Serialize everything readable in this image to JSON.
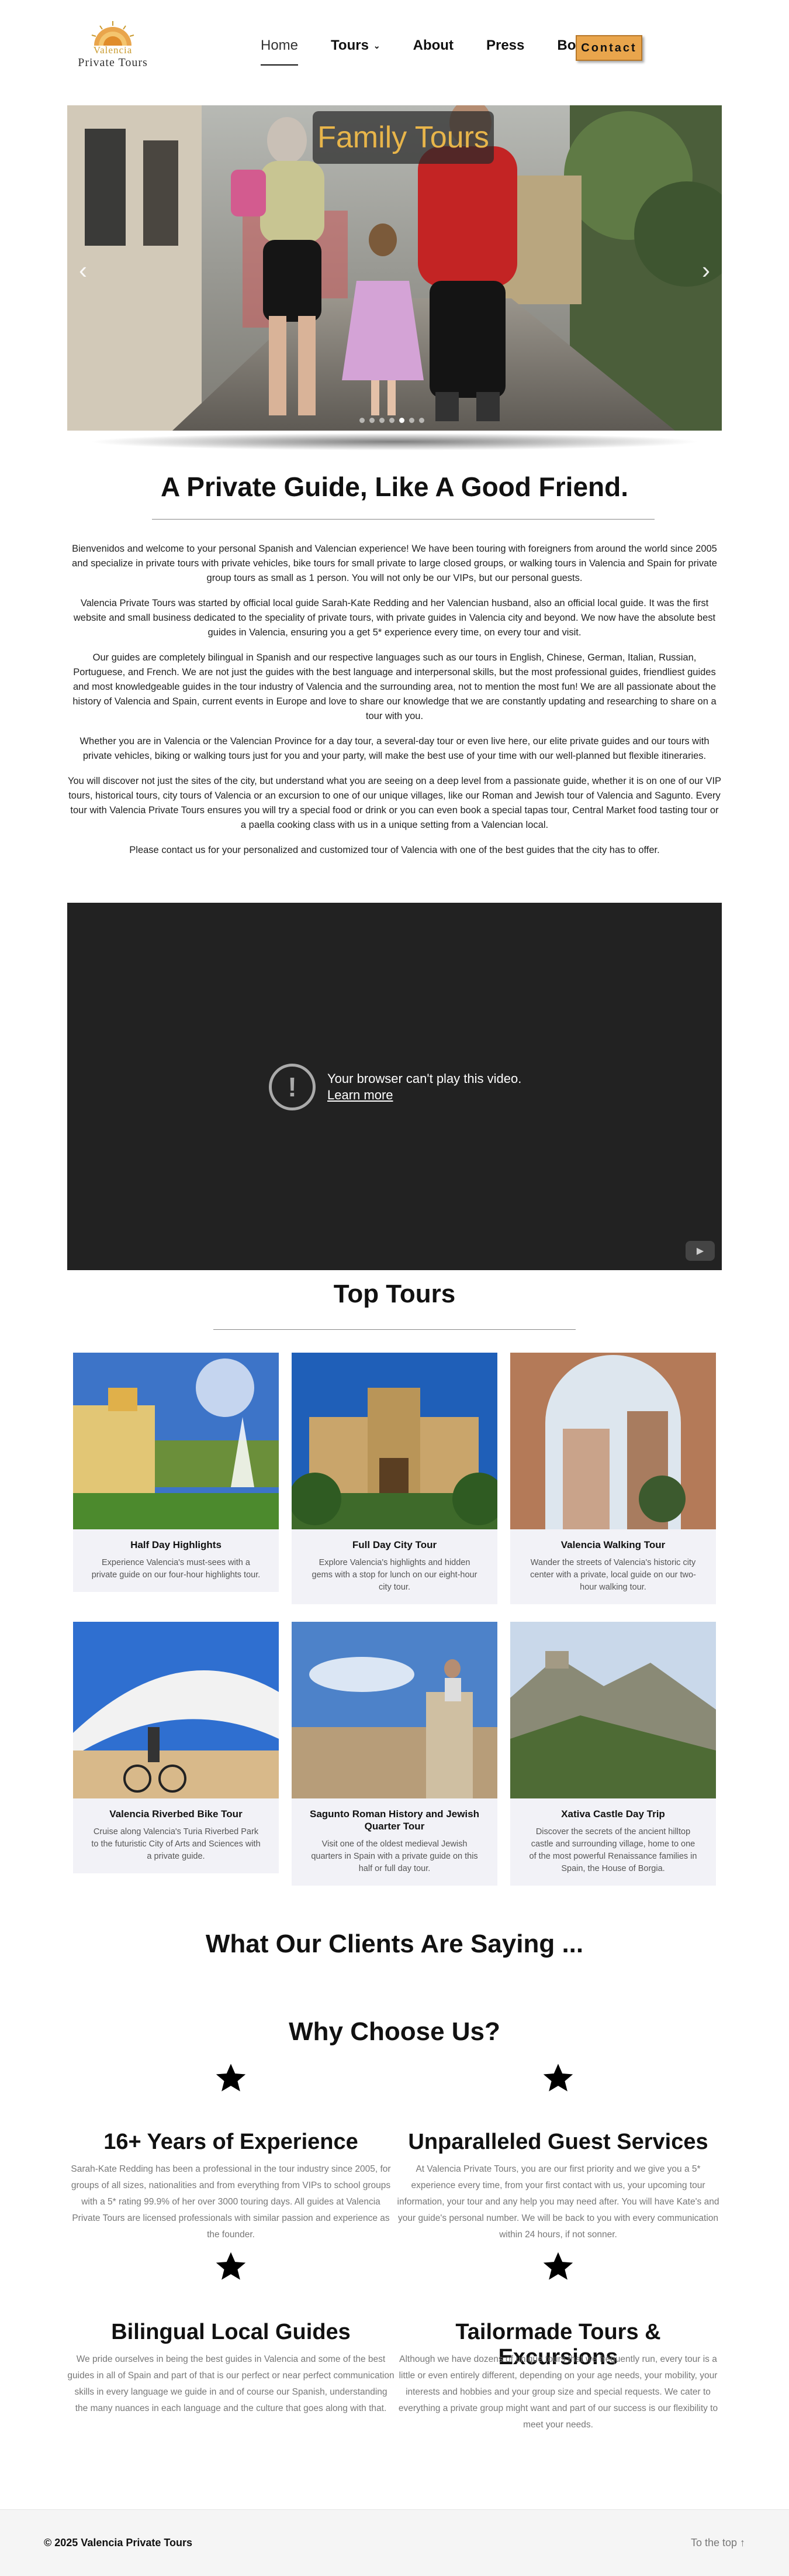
{
  "header": {
    "logo": {
      "line1": "Valencia",
      "line2": "Private Tours"
    },
    "nav": [
      {
        "label": "Home",
        "active": true
      },
      {
        "label": "Tours",
        "dropdown": true
      },
      {
        "label": "About"
      },
      {
        "label": "Press"
      },
      {
        "label": "Booking"
      }
    ],
    "contact_label": "Contact"
  },
  "hero": {
    "title": "Family Tours",
    "prev_icon": "chevron-left-icon",
    "next_icon": "chevron-right-icon",
    "slide_count": 7,
    "active_slide": 4
  },
  "intro": {
    "heading": "A Private Guide, Like A Good Friend.",
    "paragraphs": [
      "Bienvenidos and welcome to your personal Spanish and Valencian experience! We have been touring with foreigners from around the world since 2005 and specialize in private tours with private vehicles, bike tours for small private to large closed groups, or walking tours in Valencia and Spain for private group tours as small as 1 person. You will not only be our VIPs, but our personal guests.",
      "Valencia Private Tours was started by official local guide Sarah-Kate Redding and her Valencian husband, also an official local guide. It was the first website and small business dedicated to the speciality of private tours, with private guides in Valencia city and beyond. We now have the absolute best guides in Valencia, ensuring you a get 5* experience every time, on every tour and visit.",
      "Our guides are completely bilingual in Spanish and our respective languages such as our tours in English, Chinese, German, Italian, Russian, Portuguese, and French. We are not just the guides with the best language and interpersonal skills, but the most professional guides, friendliest guides and most knowledgeable guides in the tour industry of Valencia and the surrounding area, not to mention the most fun! We are all passionate about the history of Valencia and Spain, current events in Europe and love to share our knowledge that we are constantly updating and researching to share on a tour with you.",
      "Whether you are in Valencia or the Valencian Province for a day tour, a several-day tour or even live here, our elite private guides and our tours with private vehicles, biking or walking tours just for you and your party, will make the best use of your time with our well-planned but flexible itineraries.",
      "You will discover not just the sites of the city, but understand what you are seeing on a deep level from a passionate guide, whether it is on one of our VIP tours, historical tours, city tours of Valencia or an excursion to one of our unique villages, like our Roman and Jewish tour of Valencia and Sagunto. Every tour with Valencia Private Tours ensures you will try a special food or drink or you can even book a special tapas tour, Central Market food tasting tour or a paella cooking class with us in a unique setting from a Valencian local.",
      "Please contact us for your personalized and customized tour of Valencia with one of the best guides that the city has to offer."
    ]
  },
  "video": {
    "message": "Your browser can't play this video.",
    "link": "Learn more",
    "brand": "YouTube"
  },
  "tours": {
    "heading": "Top Tours",
    "items": [
      {
        "title": "Half Day Highlights",
        "desc": "Experience Valencia's must-sees with a private guide on our four-hour highlights tour."
      },
      {
        "title": "Full Day City Tour",
        "desc": "Explore Valencia's highlights and hidden gems with a stop for lunch on our eight-hour city tour."
      },
      {
        "title": "Valencia Walking Tour",
        "desc": "Wander the streets of Valencia's historic city center with a private, local guide on our two-hour walking tour."
      },
      {
        "title": "Valencia Riverbed Bike Tour",
        "desc": "Cruise along Valencia's Turia Riverbed Park to the futuristic City of Arts and Sciences with a private guide."
      },
      {
        "title": "Sagunto Roman History and Jewish Quarter Tour",
        "desc": "Visit one of the oldest medieval Jewish quarters in Spain with a private guide on this half or full day tour."
      },
      {
        "title": "Xativa Castle Day Trip",
        "desc": "Discover the secrets of the ancient hilltop castle and surrounding village, home to one of the most powerful Renaissance families in Spain, the House of Borgia."
      }
    ]
  },
  "testimonials": {
    "heading": "What Our Clients Are Saying ..."
  },
  "why": {
    "heading": "Why Choose Us?",
    "icon": "star-icon",
    "items": [
      {
        "title": "16+ Years of Experience",
        "text": "Sarah-Kate Redding has been a professional in the tour industry since 2005, for groups of all sizes, nationalities and from everything from VIPs to school groups with a 5* rating 99.9% of her over 3000 touring days. All guides at Valencia Private Tours are licensed professionals with similar passion and experience as the founder."
      },
      {
        "title": "Unparalleled Guest Services",
        "text": "At Valencia Private Tours, you are our first priority and we give you a 5* experience every time, from your first contact with us, your upcoming tour information, your tour and any help you may need after. You will have Kate's and your guide's personal number. We will be back to you with every communication within 24 hours, if not sonner."
      },
      {
        "title": "Bilingual Local Guides",
        "text": "We pride ourselves in being the best guides in Valencia and some of the best guides in all of Spain and part of that is our perfect or near perfect communication skills in every language we guide in and of course our Spanish, understanding the many nuances in each language and the culture that goes along with that."
      },
      {
        "title": "Tailormade Tours & Excursions",
        "text": "Although we have dozens of unique tours that we frequently run, every tour is a little or even entirely different, depending on your age needs, your mobility, your interests and hobbies and your group size and special requests. We cater to everything a private group might want and part of our success is our flexibility to meet your needs."
      }
    ]
  },
  "footer": {
    "copyright": "© 2025 Valencia Private Tours",
    "to_top": "To the top ↑"
  },
  "colors": {
    "accent": "#e9a54c",
    "hero_title": "#e8b54a",
    "card_bg": "#f2f2f7"
  }
}
